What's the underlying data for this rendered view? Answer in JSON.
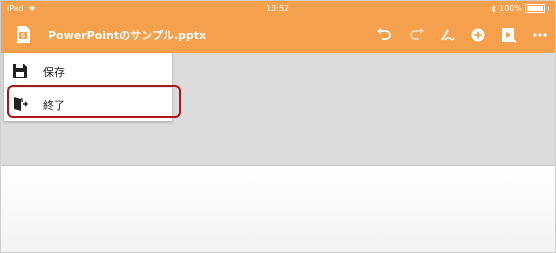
{
  "statusbar": {
    "carrier": "iPad",
    "time": "13:52",
    "battery": "100%"
  },
  "toolbar": {
    "document_title": "PowerPointのサンプル.pptx"
  },
  "menu": {
    "items": [
      {
        "label": "保存",
        "icon": "save-icon"
      },
      {
        "label": "終了",
        "icon": "exit-icon"
      }
    ]
  },
  "colors": {
    "accent": "#f4a04c",
    "highlight": "#a8191f",
    "slide_bg": "#dcdcdc"
  }
}
